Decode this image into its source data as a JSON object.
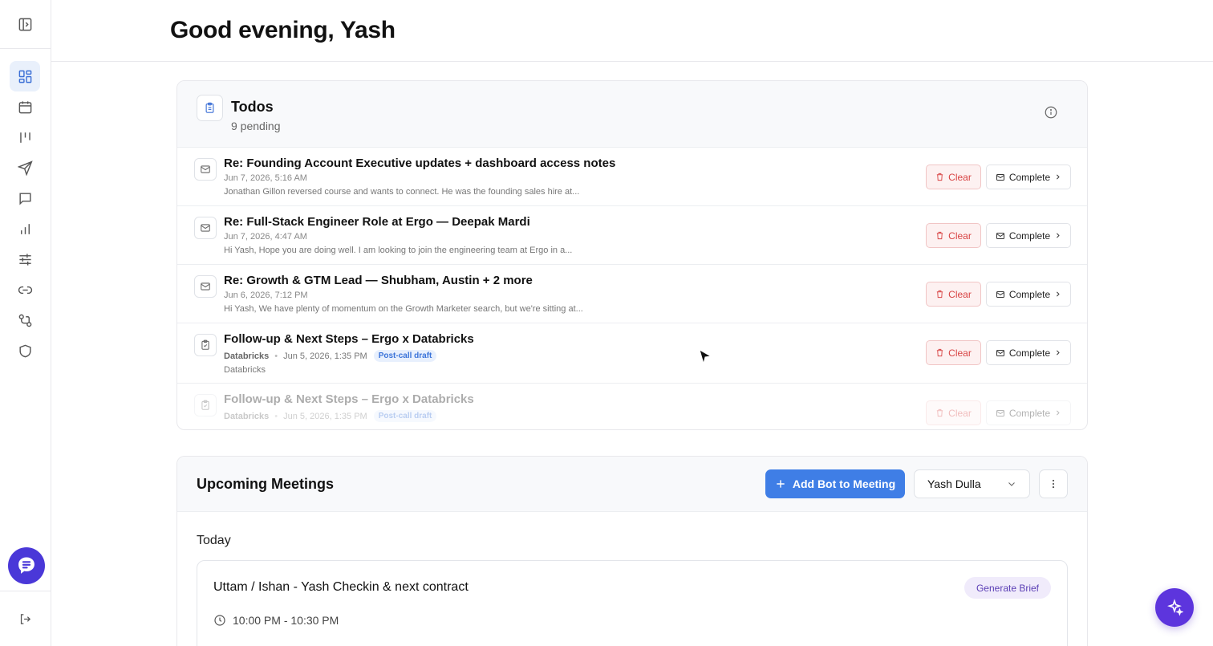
{
  "header": {
    "greeting": "Good evening, Yash"
  },
  "sidebar": {
    "items": [
      {
        "name": "dashboard-icon",
        "active": true
      },
      {
        "name": "calendar-icon"
      },
      {
        "name": "kanban-icon"
      },
      {
        "name": "send-icon"
      },
      {
        "name": "chat-icon"
      },
      {
        "name": "analytics-icon"
      },
      {
        "name": "sliders-icon"
      },
      {
        "name": "link-icon"
      },
      {
        "name": "workflow-icon"
      },
      {
        "name": "shield-icon"
      }
    ]
  },
  "todos": {
    "title": "Todos",
    "count": "9 pending",
    "clear_label": "Clear",
    "complete_label": "Complete",
    "items": [
      {
        "title": "Re: Founding Account Executive updates + dashboard access notes",
        "date": "Jun 7, 2026, 5:16 AM",
        "snippet": "Jonathan Gillon reversed course and wants to connect. He was the founding sales hire at..."
      },
      {
        "title": "Re: Full-Stack Engineer Role at Ergo — Deepak Mardi",
        "date": "Jun 7, 2026, 4:47 AM",
        "snippet": "Hi Yash, Hope you are doing well. I am looking to join the engineering team at Ergo in a..."
      },
      {
        "title": "Re: Growth & GTM Lead — Shubham, Austin + 2 more",
        "date": "Jun 6, 2026, 7:12 PM",
        "snippet": "Hi Yash, We have plenty of momentum on the Growth Marketer search, but we're sitting at..."
      },
      {
        "title": "Follow-up & Next Steps – Ergo x Databricks",
        "org": "Databricks",
        "date": "Jun 5, 2026, 1:35 PM",
        "badge": "Post-call draft",
        "sub": "Databricks"
      },
      {
        "title": "Follow-up & Next Steps – Ergo x Databricks",
        "org": "Databricks",
        "date": "Jun 5, 2026, 1:35 PM",
        "badge": "Post-call draft"
      }
    ]
  },
  "meetings": {
    "title": "Upcoming Meetings",
    "add_bot_label": "Add Bot to Meeting",
    "user_select": "Yash Dulla",
    "today_label": "Today",
    "items": [
      {
        "name": "Uttam / Ishan - Yash Checkin & next contract",
        "time": "10:00 PM - 10:30 PM",
        "brief_label": "Generate Brief"
      }
    ]
  },
  "colors": {
    "accent_blue": "#3f7ee6",
    "purple": "#5d35dd",
    "clear_red": "#d84444"
  }
}
